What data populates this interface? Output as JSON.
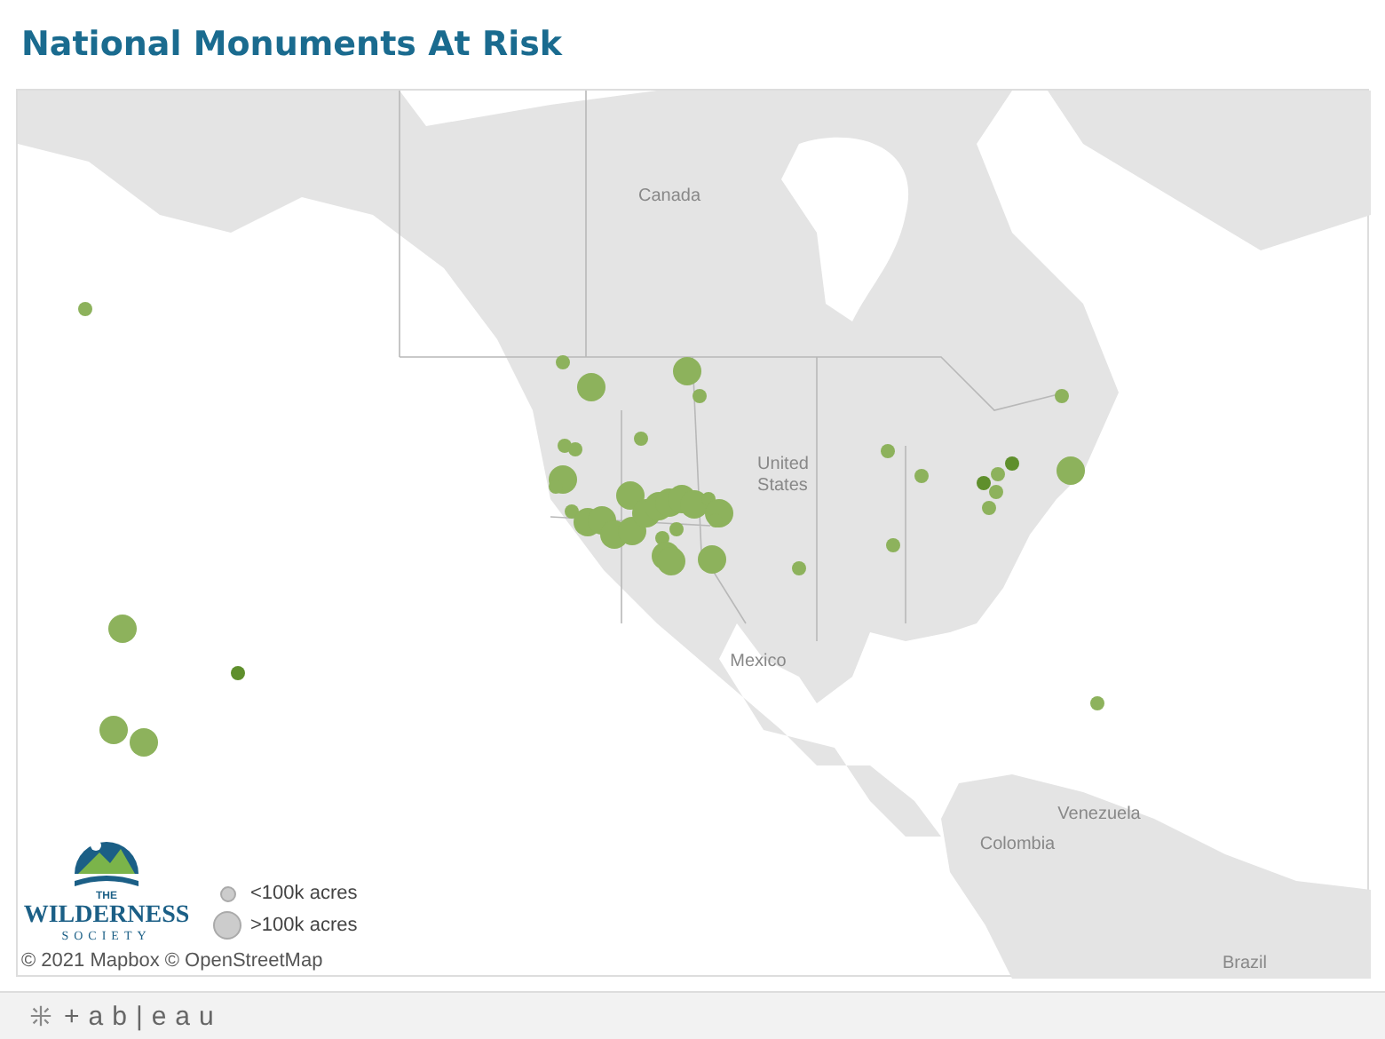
{
  "title": "National Monuments At Risk",
  "map": {
    "labels": [
      {
        "text": "Canada"
      },
      {
        "text": "United\nStates"
      },
      {
        "text": "Mexico"
      },
      {
        "text": "Venezuela"
      },
      {
        "text": "Colombia"
      },
      {
        "text": "Brazil"
      }
    ],
    "markers": [
      {
        "kind": "small",
        "color": "#8db25c"
      },
      {
        "kind": "large",
        "color": "#8db25c"
      },
      {
        "kind": "small",
        "color": "#5f8f2c"
      },
      {
        "kind": "large",
        "color": "#8db25c"
      },
      {
        "kind": "large",
        "color": "#8db25c"
      },
      {
        "kind": "small",
        "color": "#8db25c"
      },
      {
        "kind": "large",
        "color": "#8db25c"
      },
      {
        "kind": "large",
        "color": "#8db25c"
      },
      {
        "kind": "small",
        "color": "#8db25c"
      },
      {
        "kind": "small",
        "color": "#8db25c"
      },
      {
        "kind": "small",
        "color": "#8db25c"
      },
      {
        "kind": "small",
        "color": "#8db25c"
      },
      {
        "kind": "large",
        "color": "#8db25c"
      },
      {
        "kind": "small",
        "color": "#8db25c"
      },
      {
        "kind": "large",
        "color": "#8db25c"
      },
      {
        "kind": "small",
        "color": "#8db25c"
      },
      {
        "kind": "large",
        "color": "#8db25c"
      },
      {
        "kind": "large",
        "color": "#8db25c"
      },
      {
        "kind": "large",
        "color": "#8db25c"
      },
      {
        "kind": "large",
        "color": "#8db25c"
      },
      {
        "kind": "large",
        "color": "#8db25c"
      },
      {
        "kind": "large",
        "color": "#8db25c"
      },
      {
        "kind": "large",
        "color": "#8db25c"
      },
      {
        "kind": "large",
        "color": "#8db25c"
      },
      {
        "kind": "large",
        "color": "#8db25c"
      },
      {
        "kind": "small",
        "color": "#8db25c"
      },
      {
        "kind": "large",
        "color": "#8db25c"
      },
      {
        "kind": "small",
        "color": "#8db25c"
      },
      {
        "kind": "small",
        "color": "#8db25c"
      },
      {
        "kind": "small",
        "color": "#8db25c"
      },
      {
        "kind": "large",
        "color": "#8db25c"
      },
      {
        "kind": "large",
        "color": "#8db25c"
      },
      {
        "kind": "large",
        "color": "#8db25c"
      },
      {
        "kind": "small",
        "color": "#8db25c"
      },
      {
        "kind": "small",
        "color": "#8db25c"
      },
      {
        "kind": "small",
        "color": "#8db25c"
      },
      {
        "kind": "small",
        "color": "#8db25c"
      },
      {
        "kind": "small",
        "color": "#5f8f2c"
      },
      {
        "kind": "small",
        "color": "#8db25c"
      },
      {
        "kind": "small",
        "color": "#8db25c"
      },
      {
        "kind": "small",
        "color": "#8db25c"
      },
      {
        "kind": "small",
        "color": "#5f8f2c"
      },
      {
        "kind": "small",
        "color": "#8db25c"
      },
      {
        "kind": "large",
        "color": "#8db25c"
      },
      {
        "kind": "small",
        "color": "#8db25c"
      }
    ],
    "logo": {
      "line_1": "THE",
      "line_2": "WILDERNESS",
      "line_3": "SOCIETY"
    },
    "legend": [
      {
        "kind": "small",
        "label": "<100k acres"
      },
      {
        "kind": "large",
        "label": ">100k acres"
      }
    ],
    "attribution": "© 2021 Mapbox  © OpenStreetMap"
  },
  "footer": {
    "brand": "+ab|eau"
  }
}
